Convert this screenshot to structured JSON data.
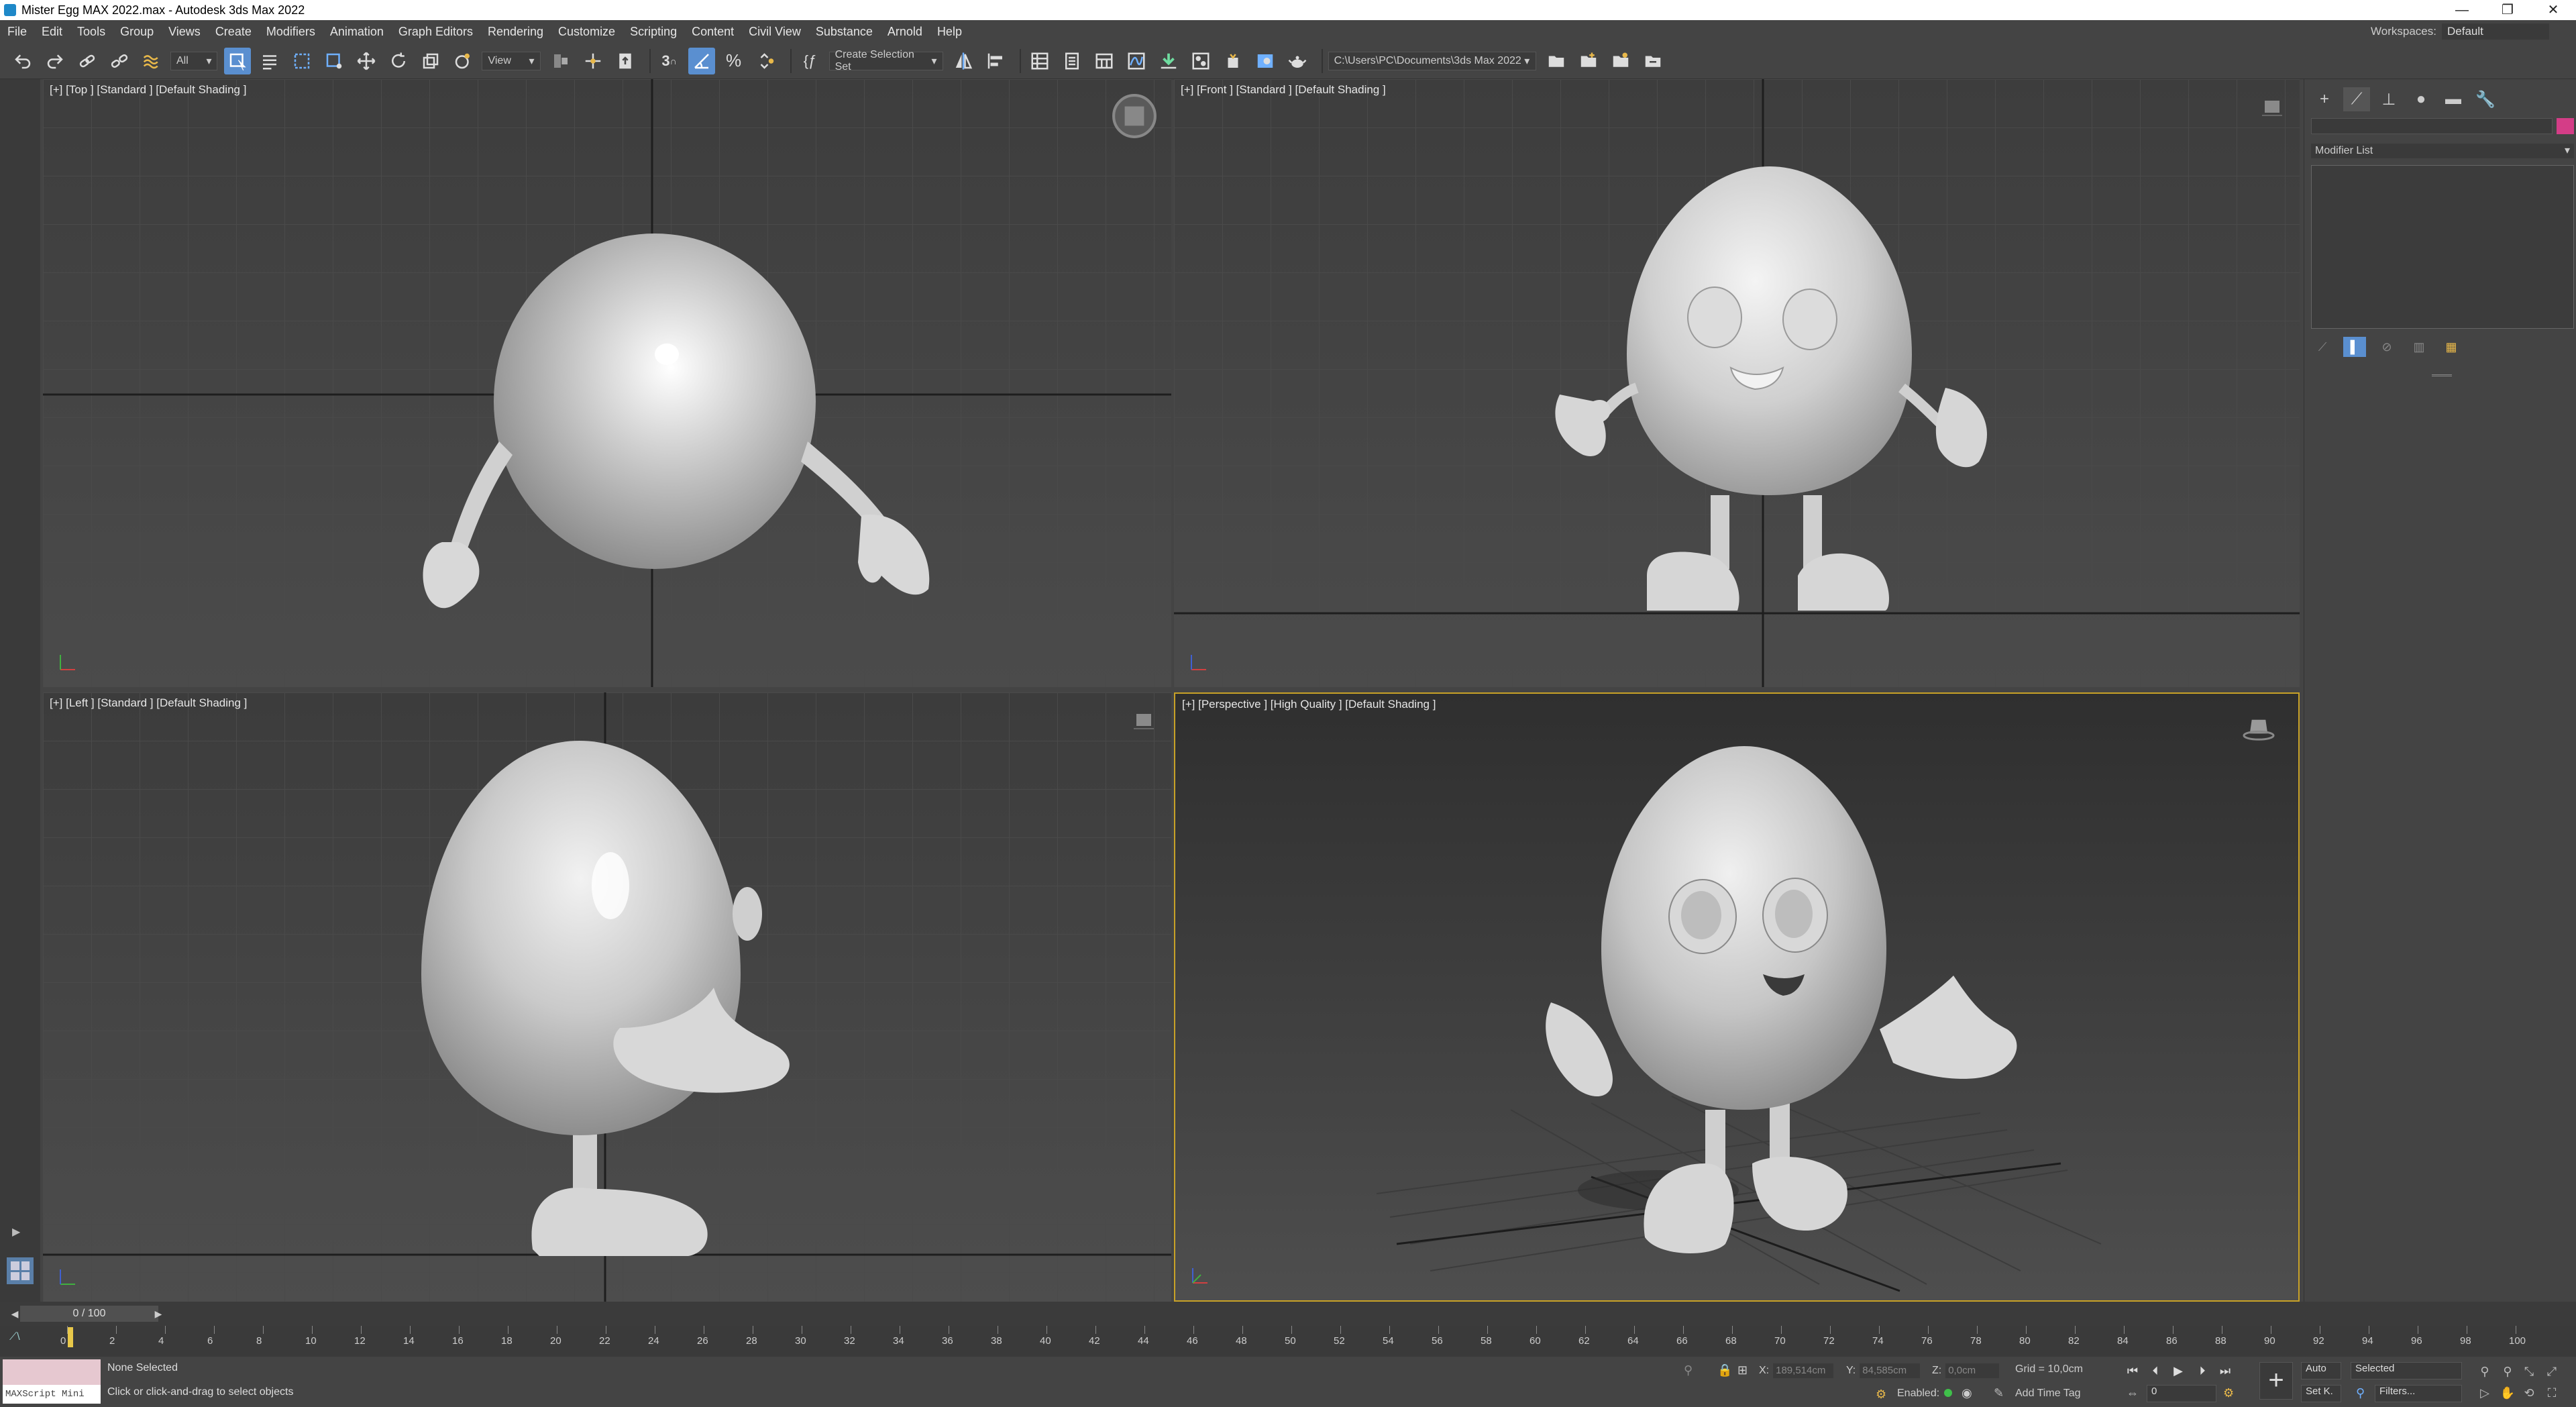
{
  "window": {
    "title": "Mister Egg MAX 2022.max - Autodesk 3ds Max 2022",
    "minimize": "—",
    "restore": "❐",
    "close": "✕"
  },
  "menu": [
    "File",
    "Edit",
    "Tools",
    "Group",
    "Views",
    "Create",
    "Modifiers",
    "Animation",
    "Graph Editors",
    "Rendering",
    "Customize",
    "Scripting",
    "Content",
    "Civil View",
    "Substance",
    "Arnold",
    "Help"
  ],
  "workspace": {
    "label": "Workspaces:",
    "value": "Default"
  },
  "toolbar": {
    "selection_filter": "All",
    "ref_coord": "View",
    "snap_label": "3",
    "selection_set": "Create Selection Set",
    "project_path": "C:\\Users\\PC\\Documents\\3ds Max 2022"
  },
  "viewports": {
    "top": "[+] [Top ] [Standard ] [Default Shading ]",
    "front": "[+] [Front ] [Standard ] [Default Shading ]",
    "left": "[+] [Left ] [Standard ] [Default Shading ]",
    "perspective": "[+] [Perspective ] [High Quality ] [Default Shading ]"
  },
  "command_panel": {
    "modifier_list": "Modifier List",
    "object_color": "#d43d87"
  },
  "time": {
    "frame": "0 / 100",
    "ticks": [
      "0",
      "2",
      "4",
      "6",
      "8",
      "10",
      "12",
      "14",
      "16",
      "18",
      "20",
      "22",
      "24",
      "26",
      "28",
      "30",
      "32",
      "34",
      "36",
      "38",
      "40",
      "42",
      "44",
      "46",
      "48",
      "50",
      "52",
      "54",
      "56",
      "58",
      "60",
      "62",
      "64",
      "66",
      "68",
      "70",
      "72",
      "74",
      "76",
      "78",
      "80",
      "82",
      "84",
      "86",
      "88",
      "90",
      "92",
      "94",
      "96",
      "98",
      "100"
    ]
  },
  "status": {
    "maxscript": "MAXScript Mini",
    "selection": "None Selected",
    "prompt": "Click or click-and-drag to select objects",
    "x_label": "X:",
    "x_val": "189,514cm",
    "y_label": "Y:",
    "y_val": "84,585cm",
    "z_label": "Z:",
    "z_val": "0,0cm",
    "grid": "Grid = 10,0cm",
    "enabled": "Enabled:",
    "add_time_tag": "Add Time Tag",
    "auto": "Auto",
    "selected": "Selected",
    "set_key": "Set K.",
    "filters": "Filters...",
    "frame_field": "0"
  }
}
